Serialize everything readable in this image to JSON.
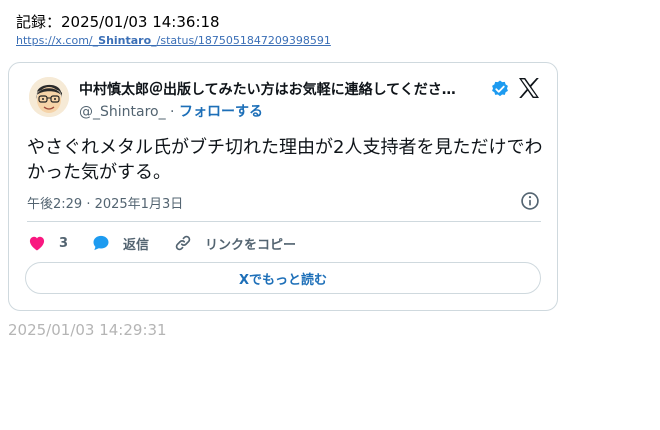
{
  "record": {
    "label": "記録：2025/01/03 14:36:18"
  },
  "source_link": {
    "prefix": "https://x.com/",
    "handle": "_Shintaro_",
    "suffix": "/status/1875051847209398591"
  },
  "tweet": {
    "author_name": "中村慎太郎＠出版してみたい方はお気軽に連絡してくださ…",
    "verified_icon": "verified-badge-icon",
    "platform_icon": "x-logo-icon",
    "handle": "@_Shintaro_",
    "separator": " · ",
    "follow_label": "フォローする",
    "text": "やさぐれメタル氏がブチ切れた理由が2人支持者を見ただけでわかった気がする。",
    "timestamp": "午後2:29 · 2025年1月3日",
    "like_count": "3",
    "reply_label": "返信",
    "copy_link_label": "リンクをコピー",
    "read_more_label": "Xでもっと読む"
  },
  "footer": {
    "recorded_time": "2025/01/03 14:29:31"
  },
  "colors": {
    "like": "#f91880",
    "reply": "#1d9bf0",
    "verified": "#1d9bf0",
    "link": "#1d6fb8"
  }
}
